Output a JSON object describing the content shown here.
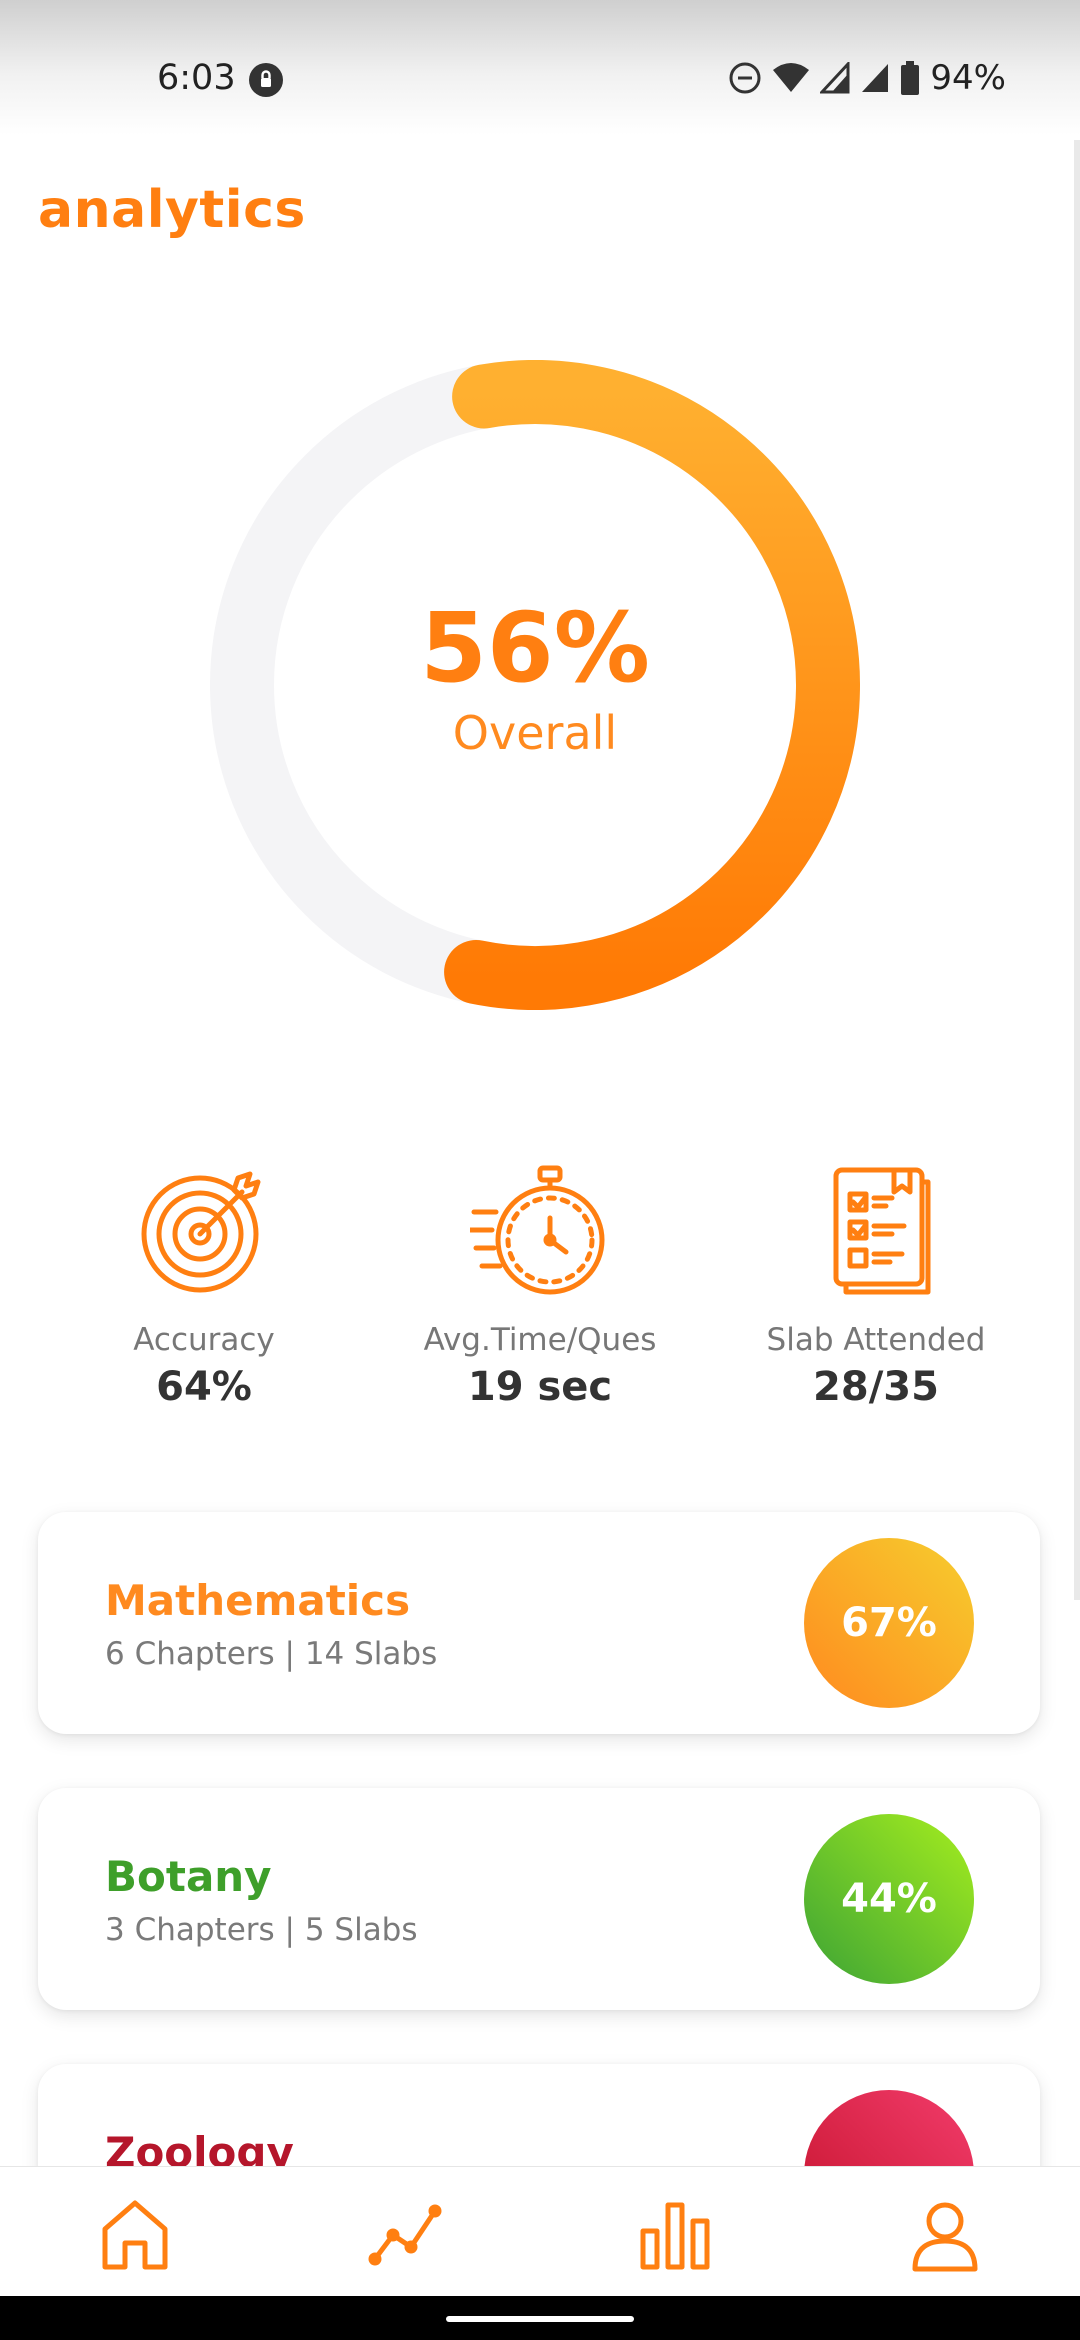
{
  "status_bar": {
    "time": "6:03",
    "battery": "94%",
    "icons": [
      "vpn-icon",
      "dnd-icon",
      "wifi-icon",
      "signal-icon",
      "signal-icon",
      "battery-icon"
    ]
  },
  "header": {
    "title": "analytics"
  },
  "overall": {
    "value": "56%",
    "label": "Overall",
    "progress_fraction": 0.56
  },
  "stats": [
    {
      "icon": "target-icon",
      "label": "Accuracy",
      "value": "64%"
    },
    {
      "icon": "stopwatch-icon",
      "label": "Avg.Time/Ques",
      "value": "19 sec"
    },
    {
      "icon": "checklist-icon",
      "label": "Slab Attended",
      "value": "28/35"
    }
  ],
  "subjects": [
    {
      "name": "Mathematics",
      "details": "6 Chapters | 14 Slabs",
      "percent": "67%",
      "color": "#FF8A1F",
      "gradient": [
        "#FF8A1F",
        "#F6CE2E"
      ]
    },
    {
      "name": "Botany",
      "details": "3 Chapters | 5 Slabs",
      "percent": "44%",
      "color": "#3E9F2A",
      "gradient": [
        "#3CA335",
        "#A6EE1E"
      ]
    },
    {
      "name": "Zoology",
      "details": "",
      "percent": "",
      "color": "#B5162B",
      "gradient": [
        "#C4122B",
        "#F23C6B"
      ]
    }
  ],
  "bottom_nav": [
    {
      "icon": "home-icon"
    },
    {
      "icon": "trend-icon"
    },
    {
      "icon": "bar-chart-icon"
    },
    {
      "icon": "profile-icon"
    }
  ],
  "colors": {
    "accent": "#FF7F11",
    "ring_track": "#F4F4F6"
  }
}
